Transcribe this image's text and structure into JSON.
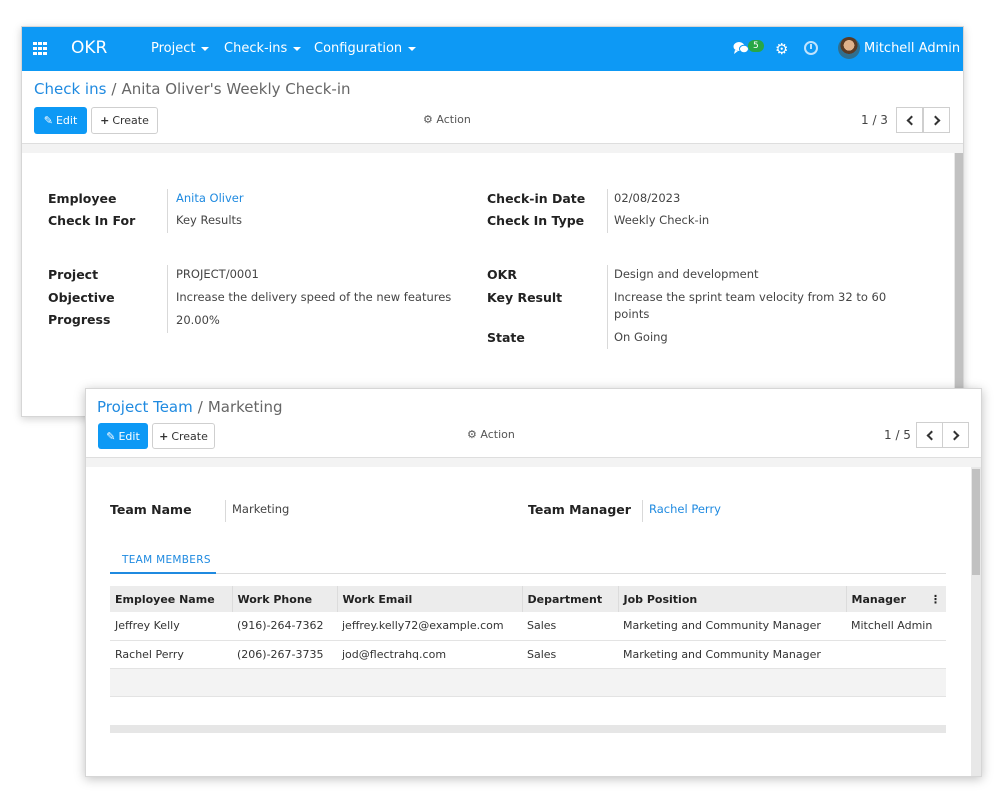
{
  "navbar": {
    "brand": "OKR",
    "menus": [
      "Project",
      "Check-ins",
      "Configuration"
    ],
    "chat_count": "5",
    "user_name": "Mitchell Admin",
    "color": "#0d99f5"
  },
  "checkin_form": {
    "breadcrumb": {
      "parent": "Check ins",
      "current": "Anita Oliver's Weekly Check-in"
    },
    "edit_label": "Edit",
    "create_label": "Create",
    "action_label": "Action",
    "pager": "1 / 3",
    "fields": {
      "employee_label": "Employee",
      "employee_value": "Anita Oliver",
      "checkin_for_label": "Check In For",
      "checkin_for_value": "Key Results",
      "checkin_date_label": "Check-in Date",
      "checkin_date_value": "02/08/2023",
      "checkin_type_label": "Check In Type",
      "checkin_type_value": "Weekly Check-in",
      "project_label": "Project",
      "project_value": "PROJECT/0001",
      "objective_label": "Objective",
      "objective_value": "Increase the delivery speed of the new features",
      "progress_label": "Progress",
      "progress_value": "20.00%",
      "okr_label": "OKR",
      "okr_value": "Design and development",
      "key_result_label": "Key Result",
      "key_result_value_line1": "Increase the sprint team velocity from 32 to 60",
      "key_result_value_line2": "points",
      "state_label": "State",
      "state_value": "On Going"
    }
  },
  "team_form": {
    "breadcrumb": {
      "parent": "Project Team",
      "current": "Marketing"
    },
    "edit_label": "Edit",
    "create_label": "Create",
    "action_label": "Action",
    "pager": "1 / 5",
    "team_name_label": "Team Name",
    "team_name_value": "Marketing",
    "team_manager_label": "Team Manager",
    "team_manager_value": "Rachel Perry",
    "tab_label": "TEAM MEMBERS",
    "columns": [
      "Employee Name",
      "Work Phone",
      "Work Email",
      "Department",
      "Job Position",
      "Manager"
    ],
    "rows": [
      [
        "Jeffrey Kelly",
        "(916)-264-7362",
        "jeffrey.kelly72@example.com",
        "Sales",
        "Marketing and Community Manager",
        "Mitchell Admin"
      ],
      [
        "Rachel Perry",
        "(206)-267-3735",
        "jod@flectrahq.com",
        "Sales",
        "Marketing and Community Manager",
        ""
      ]
    ]
  }
}
